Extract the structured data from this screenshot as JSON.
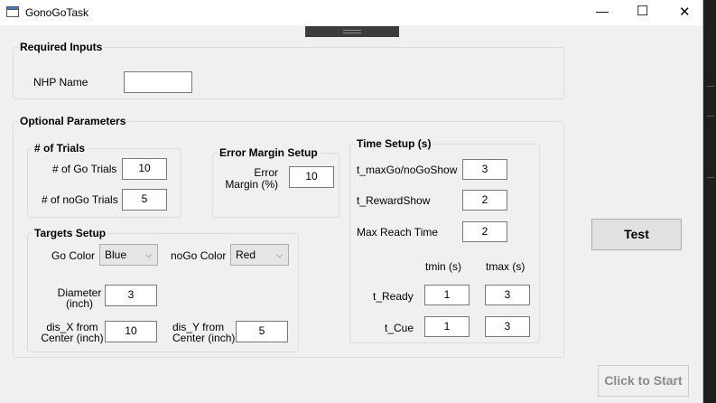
{
  "window": {
    "title": "GonoGoTask",
    "minimize": "—",
    "maximize": "☐",
    "close": "✕"
  },
  "required": {
    "title": "Required Inputs",
    "nhp_label": "NHP Name",
    "nhp_value": ""
  },
  "optional": {
    "title": "Optional Parameters"
  },
  "trials": {
    "title": "# of Trials",
    "go_label": "# of Go Trials",
    "go_value": "10",
    "nogo_label": "# of noGo Trials",
    "nogo_value": "5"
  },
  "error": {
    "title": "Error Margin Setup",
    "label_line1": "Error",
    "label_line2": "Margin (%)",
    "value": "10"
  },
  "targets": {
    "title": "Targets Setup",
    "go_color_label": "Go Color",
    "go_color": "Blue",
    "nogo_color_label": "noGo Color",
    "nogo_color": "Red",
    "diameter_line1": "Diameter",
    "diameter_line2": "(inch)",
    "diameter": "3",
    "disx_line1": "dis_X from",
    "disx_line2": "Center (inch)",
    "disx": "10",
    "disy_line1": "dis_Y from",
    "disy_line2": "Center (inch)",
    "disy": "5"
  },
  "time": {
    "title": "Time Setup (s)",
    "maxgo_label": "t_maxGo/noGoShow",
    "maxgo": "3",
    "reward_label": "t_RewardShow",
    "reward": "2",
    "reach_label": "Max Reach Time",
    "reach": "2",
    "tmin_header": "tmin (s)",
    "tmax_header": "tmax (s)",
    "ready_label": "t_Ready",
    "ready_min": "1",
    "ready_max": "3",
    "cue_label": "t_Cue",
    "cue_min": "1",
    "cue_max": "3"
  },
  "buttons": {
    "test": "Test",
    "start": "Click to Start"
  },
  "icons": {
    "app": "app-window-icon",
    "drag": "drag-handle-icon",
    "chevron": "chevron-down-icon"
  }
}
